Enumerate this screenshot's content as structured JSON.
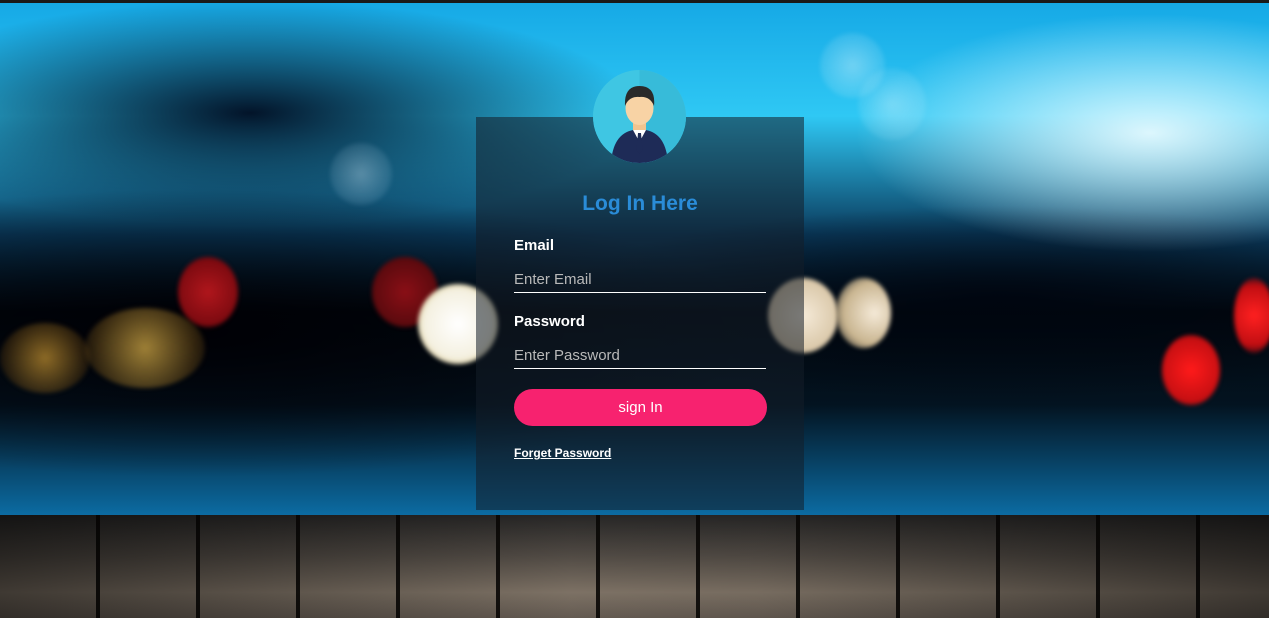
{
  "login": {
    "title": "Log In Here",
    "email_label": "Email",
    "email_placeholder": "Enter Email",
    "email_value": "",
    "password_label": "Password",
    "password_placeholder": "Enter Password",
    "password_value": "",
    "signin_label": "sign In",
    "forget_link": "Forget Password"
  },
  "colors": {
    "title": "#2a8cd8",
    "signin_button": "#f7226f",
    "avatar_bg": "#3fc6e3",
    "panel_bg": "rgba(20,30,40,0.55)"
  },
  "icons": {
    "avatar": "user-avatar-icon"
  }
}
